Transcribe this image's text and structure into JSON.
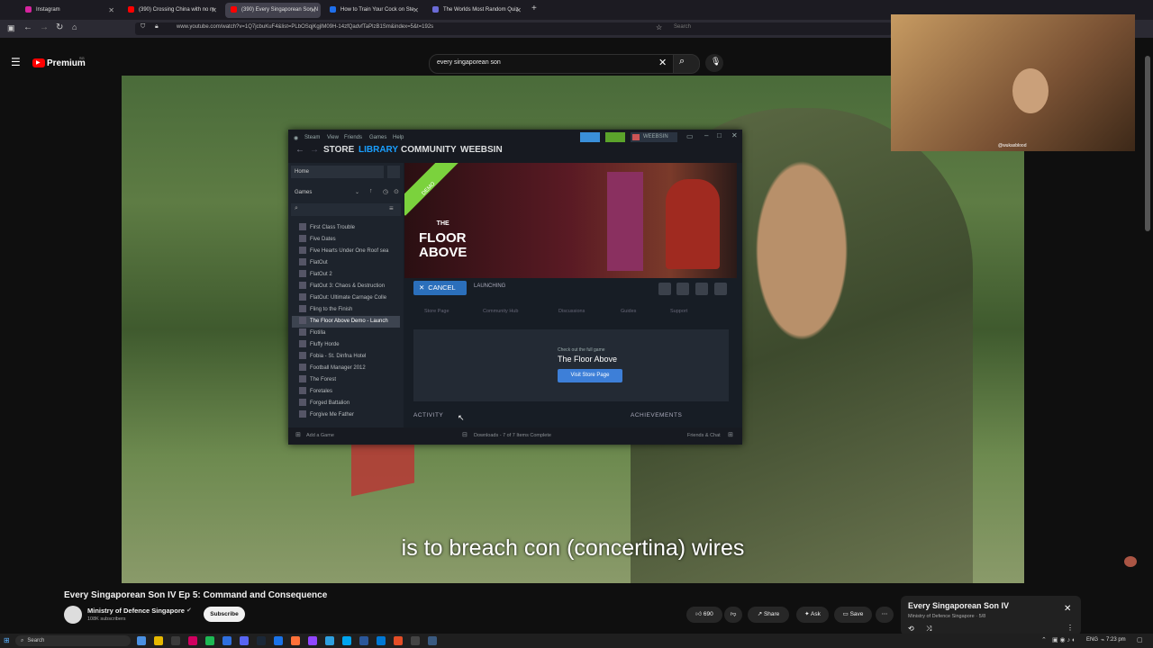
{
  "browser": {
    "tabs": [
      {
        "label": "Instagram",
        "color": "#d6249f"
      },
      {
        "label": "(390) Crossing China with no m",
        "color": "#ff0000"
      },
      {
        "label": "(390) Every Singaporean Son N",
        "color": "#ff0000"
      },
      {
        "label": "How to Train Your Cock on Ste",
        "color": "#1f6feb"
      },
      {
        "label": "The Worlds Most Random Quiz",
        "color": "#6b6bd6"
      }
    ],
    "new_tab": "+",
    "url": "www.youtube.com/watch?v=1Q7jcbuKuF4&list=PLbOSqjKgjlM09H-14zfQadvfTaPlzB1Sm&index=5&t=192s",
    "search_placeholder": "Search"
  },
  "youtube": {
    "brand": "Premium",
    "brand_badge": "SG",
    "search_query": "every singaporean son",
    "subtitle": "is to breach con (concertina) wires",
    "video_title": "Every Singaporean Son IV Ep 5: Command and Consequence",
    "channel": "Ministry of Defence Singapore",
    "subscribers": "108K subscribers",
    "subscribe_label": "Subscribe",
    "likes": "690",
    "share_label": "Share",
    "ask_label": "Ask",
    "save_label": "Save",
    "playlist": {
      "title": "Every Singaporean Son IV",
      "subtitle": "Ministry of Defence Singapore · 5/8"
    }
  },
  "webcam": {
    "tag": "@wukasblood"
  },
  "steam": {
    "menu": [
      "Steam",
      "View",
      "Friends",
      "Games",
      "Help"
    ],
    "nav": [
      "STORE",
      "LIBRARY",
      "COMMUNITY",
      "WEEBSIN"
    ],
    "user": "WEEBSIN",
    "home": "Home",
    "games_label": "Games",
    "games": [
      "First Class Trouble",
      "Five Dates",
      "Five Hearts Under One Roof sea",
      "FlatOut",
      "FlatOut 2",
      "FlatOut 3: Chaos & Destruction",
      "FlatOut: Ultimate Carnage Colle",
      "Fling to the Finish",
      "The Floor Above Demo - Launch",
      "Flotilla",
      "Fluffy Horde",
      "Fobia - St. Dinfna Hotel",
      "Football Manager 2012",
      "The Forest",
      "Foretales",
      "Forged Battalion",
      "Forgive Me Father"
    ],
    "selected_game_index": 8,
    "demo_banner": "DEMO",
    "logo_line1": "THE",
    "logo_line2": "FLOOR",
    "logo_line3": "ABOVE",
    "cancel_label": "CANCEL",
    "status": "LAUNCHING",
    "links": [
      "Store Page",
      "Community Hub",
      "Discussions",
      "Guides",
      "Support"
    ],
    "promo_small": "Check out the full game",
    "promo_title": "The Floor Above",
    "promo_button": "Visit Store Page",
    "activity": "ACTIVITY",
    "achievements": "ACHIEVEMENTS",
    "add_game": "Add a Game",
    "downloads": "Downloads - 7 of 7 Items Complete",
    "friends": "Friends & Chat"
  },
  "taskbar": {
    "search": "Search",
    "lang": "ENG",
    "time": "7:23 pm"
  }
}
